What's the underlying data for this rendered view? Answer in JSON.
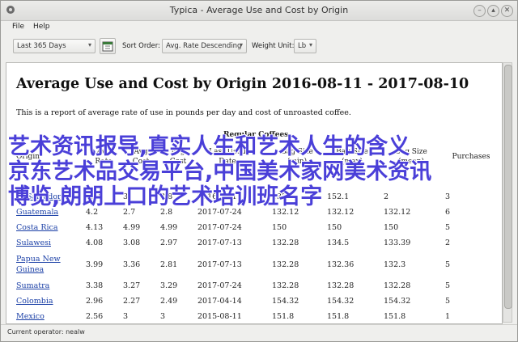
{
  "window": {
    "title": "Typica - Average Use and Cost by Origin"
  },
  "menu": {
    "file": "File",
    "help": "Help"
  },
  "toolbar": {
    "date_range": "Last 365 Days",
    "sort_label": "Sort Order:",
    "sort_value": "Avg. Rate Descending",
    "weight_label": "Weight Unit:",
    "weight_value": "Lb"
  },
  "report": {
    "title": "Average Use and Cost by Origin 2016-08-11 - 2017-08-10",
    "description": "This is a report of average rate of use in pounds per day and cost of unroasted coffee.",
    "group_header": "Regular Coffees",
    "columns": [
      "Origin",
      "Avg Rate",
      "Avg Cost",
      "Avg Cost",
      "Last Used Date",
      "Bag Size (min)",
      "Bag Size (max)",
      "Bag Size (mean)",
      "Purchases"
    ],
    "rows": [
      [
        "El Salvador",
        "4.58",
        "3",
        "2.8",
        "2016-12-1",
        "132",
        "152.1",
        "2",
        "3"
      ],
      [
        "Guatemala",
        "4.2",
        "2.7",
        "2.8",
        "2017-07-24",
        "132.12",
        "132.12",
        "132.12",
        "6"
      ],
      [
        "Costa Rica",
        "4.13",
        "4.99",
        "4.99",
        "2017-07-24",
        "150",
        "150",
        "150",
        "5"
      ],
      [
        "Sulawesi",
        "4.08",
        "3.08",
        "2.97",
        "2017-07-13",
        "132.28",
        "134.5",
        "133.39",
        "2"
      ],
      [
        "Papua New Guinea",
        "3.99",
        "3.36",
        "2.81",
        "2017-07-13",
        "132.28",
        "132.36",
        "132.3",
        "5"
      ],
      [
        "Sumatra",
        "3.38",
        "3.27",
        "3.29",
        "2017-07-24",
        "132.28",
        "132.28",
        "132.28",
        "5"
      ],
      [
        "Colombia",
        "2.96",
        "2.27",
        "2.49",
        "2017-04-14",
        "154.32",
        "154.32",
        "154.32",
        "5"
      ],
      [
        "Mexico",
        "2.56",
        "3",
        "3",
        "2015-08-11",
        "151.8",
        "151.8",
        "151.8",
        "1"
      ]
    ]
  },
  "overlay": {
    "line1": "艺术资讯报导,真实人生和艺术人生的含义",
    "line2": "京东艺术品交易平台,中国美术家网美术资讯",
    "line3": "博览,朗朗上口的艺术培训班名字"
  },
  "status": {
    "operator": "Current operator: nealw"
  }
}
